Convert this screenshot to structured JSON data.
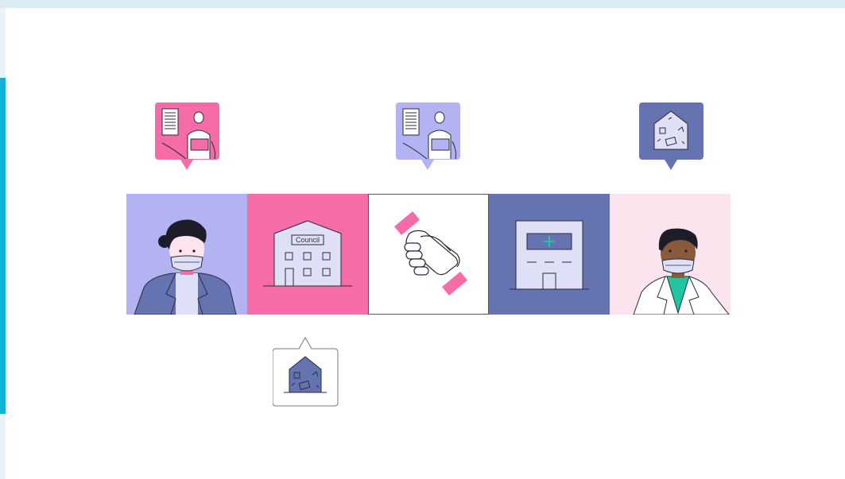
{
  "colors": {
    "lavender": "#b3b2f2",
    "pink": "#f56ca6",
    "navy": "#6573b1",
    "light_pink": "#fce4ee",
    "white": "#ffffff",
    "teal": "#22c5a1",
    "stroke": "#2b2b3a"
  },
  "strip": {
    "tiles": [
      {
        "icon": "person-mask-icon"
      },
      {
        "icon": "council-building-icon",
        "sign": "Council"
      },
      {
        "icon": "handshake-icon"
      },
      {
        "icon": "clinic-building-icon"
      },
      {
        "icon": "doctor-mask-icon"
      }
    ]
  },
  "bubbles": [
    {
      "icon": "document-person-icon",
      "color": "#f56ca6"
    },
    {
      "icon": "document-person-icon",
      "color": "#b3b2f2"
    },
    {
      "icon": "damaged-house-icon",
      "color": "#6573b1"
    },
    {
      "icon": "damaged-house-icon",
      "color": "#ffffff"
    }
  ]
}
